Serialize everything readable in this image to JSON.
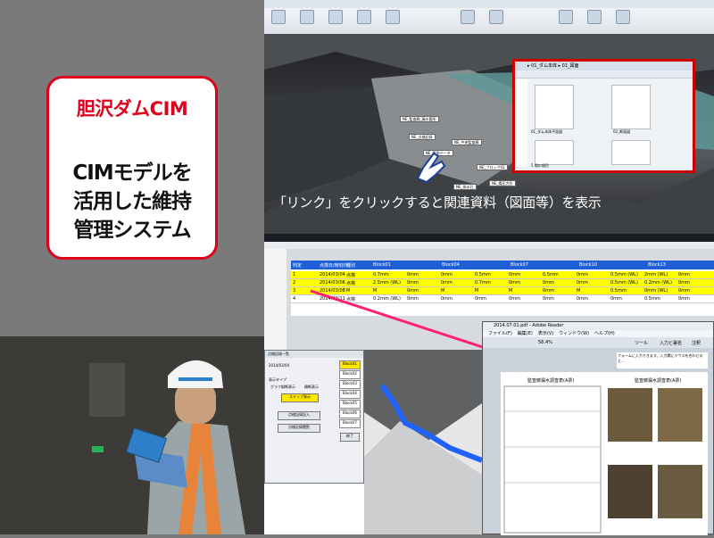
{
  "title_card": {
    "title": "胆沢ダムCIM",
    "line1": "CIMモデルを",
    "line2": "活用した維持",
    "line3": "管理システム"
  },
  "caption": "「リンク」をクリックすると関連資料（図面等）を表示",
  "data_table": {
    "headers": [
      "判定",
      "点検日/時刻日",
      "種別",
      "Block01",
      "Block04",
      "Block07",
      "Block10",
      "Block13"
    ],
    "rows": [
      {
        "id": "1",
        "date": "2014/03/04",
        "type": "点検",
        "vals": [
          "0.7mm",
          "0mm",
          "0mm",
          "0.5mm",
          "0mm",
          "0.5mm",
          "0mm",
          "0.5mm (WL)",
          "2mm (WL)",
          "0mm"
        ]
      },
      {
        "id": "2",
        "date": "2014/03/06",
        "type": "点検",
        "vals": [
          "2.5mm (WL)",
          "0mm",
          "0mm",
          "0.7mm",
          "0mm",
          "0mm",
          "0mm",
          "0.5mm (WL)",
          "0.2mm (WL)",
          "0mm"
        ]
      },
      {
        "id": "3",
        "date": "2014/03/08",
        "type": "M",
        "vals": [
          "M",
          "0mm",
          "M",
          "M",
          "M",
          "0mm",
          "M",
          "0.5mm",
          "0mm (WL)",
          "0mm"
        ]
      },
      {
        "id": "4",
        "date": "2014/03/11",
        "type": "点検",
        "vals": [
          "0.2mm (WL)",
          "0mm",
          "0mm",
          "0mm",
          "0mm",
          "0mm",
          "0mm",
          "0mm",
          "0.5mm",
          "0mm"
        ]
      }
    ]
  },
  "form": {
    "title": "点検記録一覧",
    "date_label": "2014/03/04",
    "view_label": "表示タイプ",
    "opt1": "グラフ縦断表示",
    "opt2": "横断表示",
    "btn_step": "ステップ表示",
    "btn_record": "点検記録記入",
    "btn_record2": "点検記録閲覧",
    "btn_close": "終了",
    "blocks": [
      "Block01",
      "Block02",
      "Block03",
      "Block04",
      "Block05",
      "Block06",
      "Block07"
    ]
  },
  "pdf": {
    "window_title": "2014.07.01.pdf - Adobe Reader",
    "menu": [
      "ファイル(F)",
      "編集(E)",
      "表示(V)",
      "ウィンドウ(W)",
      "ヘルプ(H)"
    ],
    "tools": [
      "ツール",
      "入力と署名",
      "注釈"
    ],
    "zoom": "58.4%",
    "sheet_title_left": "監査廊漏水調査表(A票)",
    "sheet_title_right": "監査廊漏水調査表(A票)",
    "notice": "フォームに入力できます。入力欄にマウスを合わせると..."
  },
  "explorer": {
    "address": "▸ 01_ダム本体 ▸ 01_図面",
    "file1": "01_ダム本体平面図",
    "file2": "02_断面図",
    "status": "5 個の項目"
  },
  "labels_3d": [
    "NE_監査廊_漏水箇所",
    "NE_点検記録",
    "NE_観測データ",
    "NE_中央監査廊",
    "NE_ブロック02",
    "NE_排水孔",
    "NE_揚圧力計"
  ],
  "colors": {
    "accent": "#e0001b",
    "highlight_row": "#ffff00",
    "header_row": "#1f5fd6"
  }
}
